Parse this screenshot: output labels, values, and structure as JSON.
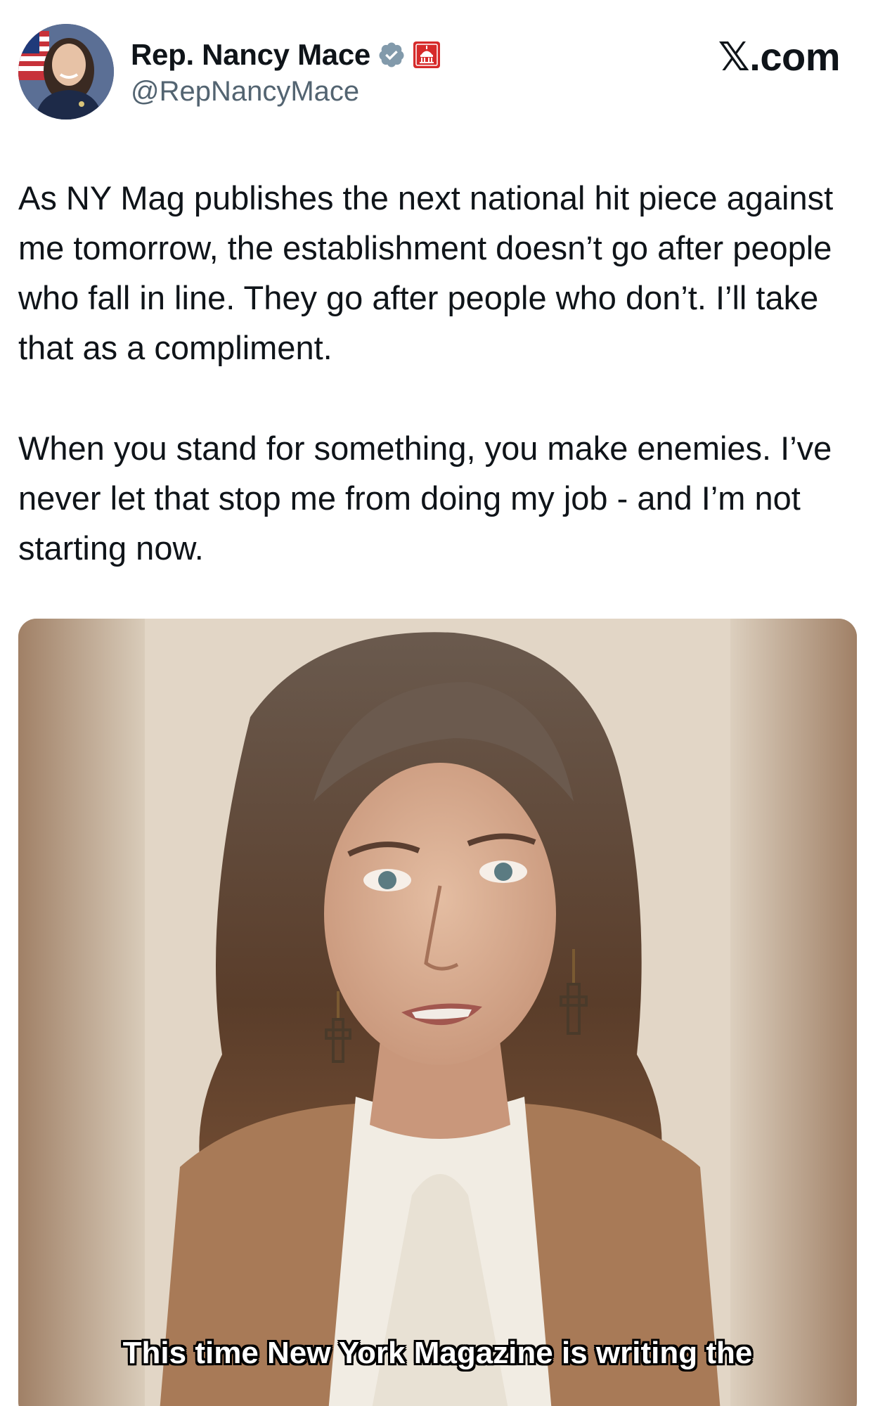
{
  "author": {
    "display_name": "Rep. Nancy Mace",
    "handle": "@RepNancyMace",
    "verified_badge_icon": "verified-badge-icon",
    "affiliation_icon": "house-gop-capitol-icon"
  },
  "brand": {
    "label": "𝕏.com"
  },
  "tweet": {
    "paragraphs": [
      "As NY Mag publishes the next national hit piece against me tomorrow, the establishment doesn’t go after people who fall in line. They go after people who don’t. I’ll take that as a compliment.",
      "When you stand for something, you make enemies. I’ve never let that stop me from doing my job - and I’m not starting now."
    ]
  },
  "media": {
    "type": "video",
    "caption": "This time New York Magazine is writing the"
  },
  "colors": {
    "text_primary": "#0f1419",
    "text_secondary": "#536471",
    "verified_gray": "#829aab",
    "affiliation_red": "#d62b2b"
  }
}
